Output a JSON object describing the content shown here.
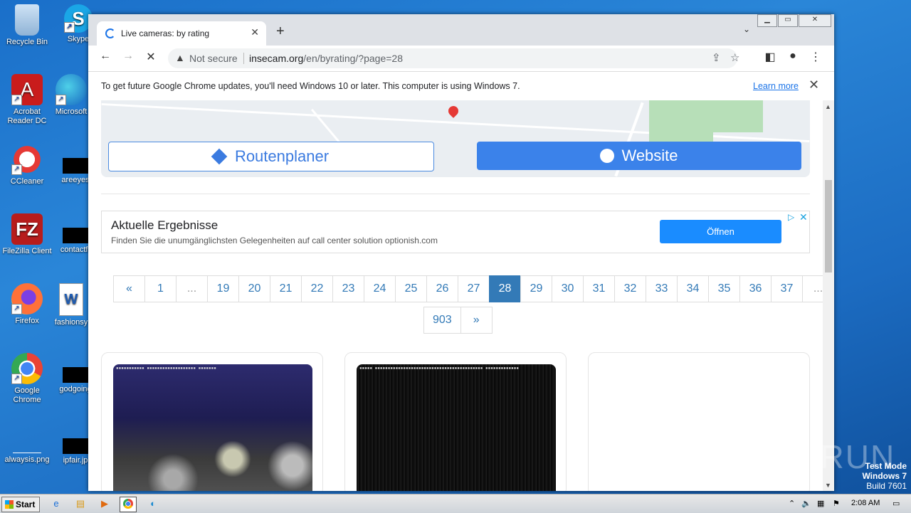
{
  "desktop": {
    "icons": [
      {
        "label": "Recycle Bin"
      },
      {
        "label": "Skype"
      },
      {
        "label": "Acrobat Reader DC"
      },
      {
        "label": "Microsoft"
      },
      {
        "label": "CCleaner"
      },
      {
        "label": "areeyes"
      },
      {
        "label": "FileZilla Client"
      },
      {
        "label": "contactfr"
      },
      {
        "label": "Firefox"
      },
      {
        "label": "fashionsy"
      },
      {
        "label": "Google Chrome"
      },
      {
        "label": "godgoing"
      },
      {
        "label": "alwaysis.png"
      },
      {
        "label": "ipfair.jp"
      }
    ],
    "watermark": "ANY RUN",
    "test_mode": {
      "line1": "Test Mode",
      "line2": "Windows 7",
      "line3": "Build 7601"
    }
  },
  "browser": {
    "tab_title": "Live cameras: by rating",
    "new_tab": "+",
    "security_label": "Not secure",
    "url_host": "insecam.org",
    "url_path": "/en/byrating/?page=28",
    "infobar_message": "To get future Google Chrome updates, you'll need Windows 10 or later. This computer is using Windows 7.",
    "infobar_link": "Learn more"
  },
  "page": {
    "route_button": "Routenplaner",
    "website_button": "Website",
    "ad": {
      "headline": "Aktuelle Ergebnisse",
      "subline": "Finden Sie die unumgänglichsten Gelegenheiten auf call center solution optionish.com",
      "cta": "Öffnen"
    },
    "pagination_row1": [
      "«",
      "1",
      "...",
      "19",
      "20",
      "21",
      "22",
      "23",
      "24",
      "25",
      "26",
      "27",
      "28",
      "29",
      "30",
      "31",
      "32",
      "33",
      "34",
      "35",
      "36",
      "37",
      "..."
    ],
    "pagination_row2": [
      "903",
      "»"
    ],
    "active_page": "28"
  },
  "taskbar": {
    "start_label": "Start",
    "clock": "2:08 AM"
  }
}
